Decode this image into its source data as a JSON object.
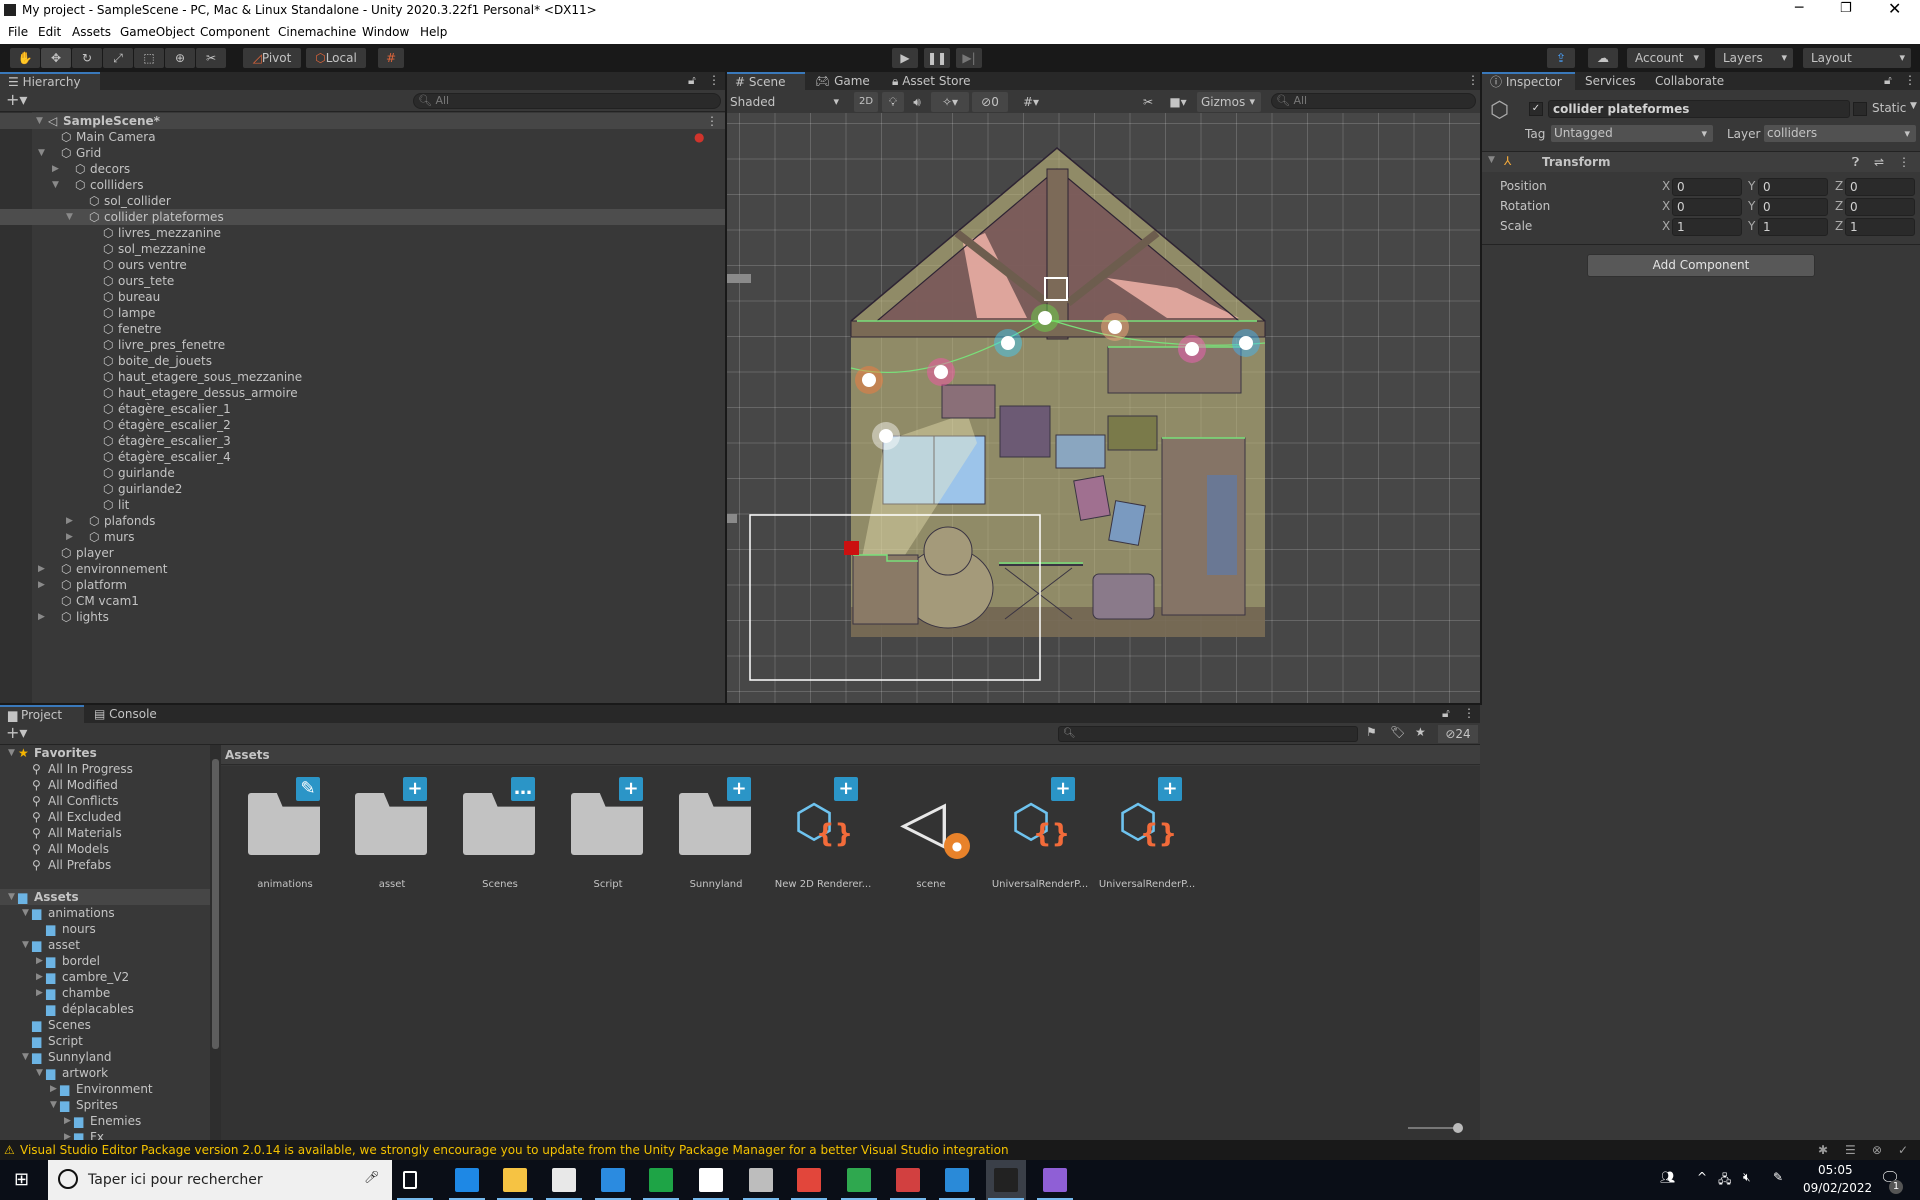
{
  "window": {
    "title": "My project - SampleScene - PC, Mac & Linux Standalone - Unity 2020.3.22f1 Personal* <DX11>"
  },
  "menu": [
    "File",
    "Edit",
    "Assets",
    "GameObject",
    "Component",
    "Cinemachine",
    "Window",
    "Help"
  ],
  "toolbar": {
    "tools": [
      "hand-tool",
      "move-tool",
      "rotate-tool",
      "scale-tool",
      "rect-tool",
      "transform-tool",
      "custom-tool"
    ],
    "active_tool": "move-tool",
    "pivot_label": "Pivot",
    "local_label": "Local",
    "account_label": "Account",
    "layers_label": "Layers",
    "layout_label": "Layout"
  },
  "hierarchy": {
    "tab_label": "Hierarchy",
    "search_placeholder": "All",
    "items": [
      {
        "label": "SampleScene*",
        "depth": 0,
        "arrow": "down",
        "scene": true
      },
      {
        "label": "Main Camera",
        "depth": 1,
        "arrow": null,
        "flag": true
      },
      {
        "label": "Grid",
        "depth": 1,
        "arrow": "down"
      },
      {
        "label": "decors",
        "depth": 2,
        "arrow": "right"
      },
      {
        "label": "collliders",
        "depth": 2,
        "arrow": "down"
      },
      {
        "label": "sol_collider",
        "depth": 3,
        "arrow": null
      },
      {
        "label": "collider plateformes",
        "depth": 3,
        "arrow": "down",
        "selected": true
      },
      {
        "label": "livres_mezzanine",
        "depth": 4,
        "arrow": null
      },
      {
        "label": "sol_mezzanine",
        "depth": 4,
        "arrow": null
      },
      {
        "label": "ours ventre",
        "depth": 4,
        "arrow": null
      },
      {
        "label": "ours_tete",
        "depth": 4,
        "arrow": null
      },
      {
        "label": "bureau",
        "depth": 4,
        "arrow": null
      },
      {
        "label": "lampe",
        "depth": 4,
        "arrow": null
      },
      {
        "label": "fenetre",
        "depth": 4,
        "arrow": null
      },
      {
        "label": "livre_pres_fenetre",
        "depth": 4,
        "arrow": null
      },
      {
        "label": "boite_de_jouets",
        "depth": 4,
        "arrow": null
      },
      {
        "label": "haut_etagere_sous_mezzanine",
        "depth": 4,
        "arrow": null
      },
      {
        "label": "haut_etagere_dessus_armoire",
        "depth": 4,
        "arrow": null
      },
      {
        "label": "étagère_escalier_1",
        "depth": 4,
        "arrow": null
      },
      {
        "label": "étagère_escalier_2",
        "depth": 4,
        "arrow": null
      },
      {
        "label": "étagère_escalier_3",
        "depth": 4,
        "arrow": null
      },
      {
        "label": "étagère_escalier_4",
        "depth": 4,
        "arrow": null
      },
      {
        "label": "guirlande",
        "depth": 4,
        "arrow": null
      },
      {
        "label": "guirlande2",
        "depth": 4,
        "arrow": null
      },
      {
        "label": "lit",
        "depth": 4,
        "arrow": null
      },
      {
        "label": "plafonds",
        "depth": 3,
        "arrow": "right"
      },
      {
        "label": "murs",
        "depth": 3,
        "arrow": "right"
      },
      {
        "label": "player",
        "depth": 1,
        "arrow": null
      },
      {
        "label": "environnement",
        "depth": 1,
        "arrow": "right"
      },
      {
        "label": "platform",
        "depth": 1,
        "arrow": "right"
      },
      {
        "label": "CM vcam1",
        "depth": 1,
        "arrow": null
      },
      {
        "label": "lights",
        "depth": 1,
        "arrow": "right"
      }
    ]
  },
  "scene": {
    "tabs": [
      {
        "label": "Scene",
        "icon": "grid-icon",
        "active": true
      },
      {
        "label": "Game",
        "icon": "gamepad-icon"
      },
      {
        "label": "Asset Store",
        "icon": "bag-icon"
      }
    ],
    "shading_mode": "Shaded",
    "mode_2d": "2D",
    "hidden_count": "0",
    "gizmos_label": "Gizmos",
    "search_placeholder": "All",
    "light_colors": [
      "#ff7a3a",
      "#ff4fb0",
      "#3fd0ff",
      "#6be04a",
      "#ffb080",
      "#ff5fc0",
      "#3fb8ff",
      "#ffffff"
    ]
  },
  "inspector": {
    "tabs": [
      "Inspector",
      "Services",
      "Collaborate"
    ],
    "active": true,
    "object_name": "collider plateformes",
    "static_label": "Static",
    "static": false,
    "tag_label": "Tag",
    "tag_value": "Untagged",
    "layer_label": "Layer",
    "layer_value": "colliders",
    "transform": {
      "title": "Transform",
      "rows": [
        {
          "label": "Position",
          "x": "0",
          "y": "0",
          "z": "0"
        },
        {
          "label": "Rotation",
          "x": "0",
          "y": "0",
          "z": "0"
        },
        {
          "label": "Scale",
          "x": "1",
          "y": "1",
          "z": "1"
        }
      ],
      "axes": [
        "X",
        "Y",
        "Z"
      ]
    },
    "add_component_label": "Add Component"
  },
  "project": {
    "tabs": [
      "Project",
      "Console"
    ],
    "hidden_count": "24",
    "breadcrumb": "Assets",
    "tree": [
      {
        "label": "Favorites",
        "depth": 0,
        "arrow": "down",
        "type": "star",
        "bold": true
      },
      {
        "label": "All In Progress",
        "depth": 1,
        "type": "search"
      },
      {
        "label": "All Modified",
        "depth": 1,
        "type": "search"
      },
      {
        "label": "All Conflicts",
        "depth": 1,
        "type": "search"
      },
      {
        "label": "All Excluded",
        "depth": 1,
        "type": "search"
      },
      {
        "label": "All Materials",
        "depth": 1,
        "type": "search"
      },
      {
        "label": "All Models",
        "depth": 1,
        "type": "search"
      },
      {
        "label": "All Prefabs",
        "depth": 1,
        "type": "search"
      },
      {
        "label": "",
        "depth": 0,
        "type": "blank"
      },
      {
        "label": "Assets",
        "depth": 0,
        "arrow": "down",
        "type": "folder",
        "bold": true,
        "selected": true
      },
      {
        "label": "animations",
        "depth": 1,
        "arrow": "down",
        "type": "folder"
      },
      {
        "label": "nours",
        "depth": 2,
        "type": "folder"
      },
      {
        "label": "asset",
        "depth": 1,
        "arrow": "down",
        "type": "folder"
      },
      {
        "label": "bordel",
        "depth": 2,
        "arrow": "right",
        "type": "folder"
      },
      {
        "label": "cambre_V2",
        "depth": 2,
        "arrow": "right",
        "type": "folder"
      },
      {
        "label": "chambe",
        "depth": 2,
        "arrow": "right",
        "type": "folder"
      },
      {
        "label": "déplacables",
        "depth": 2,
        "type": "folder"
      },
      {
        "label": "Scenes",
        "depth": 1,
        "type": "folder"
      },
      {
        "label": "Script",
        "depth": 1,
        "type": "folder"
      },
      {
        "label": "Sunnyland",
        "depth": 1,
        "arrow": "down",
        "type": "folder"
      },
      {
        "label": "artwork",
        "depth": 2,
        "arrow": "down",
        "type": "folder"
      },
      {
        "label": "Environment",
        "depth": 3,
        "arrow": "right",
        "type": "folder"
      },
      {
        "label": "Sprites",
        "depth": 3,
        "arrow": "down",
        "type": "folder"
      },
      {
        "label": "Enemies",
        "depth": 4,
        "arrow": "right",
        "type": "folder"
      },
      {
        "label": "Fx",
        "depth": 4,
        "arrow": "right",
        "type": "folder"
      }
    ],
    "assets": [
      {
        "label": "animations",
        "type": "folder",
        "badge": "pencil"
      },
      {
        "label": "asset",
        "type": "folder",
        "badge": "plus"
      },
      {
        "label": "Scenes",
        "type": "folder",
        "badge": "dots"
      },
      {
        "label": "Script",
        "type": "folder",
        "badge": "plus"
      },
      {
        "label": "Sunnyland",
        "type": "folder",
        "badge": "plus"
      },
      {
        "label": "New 2D Renderer...",
        "type": "renderer",
        "badge": "plus"
      },
      {
        "label": "scene",
        "type": "unity-scene",
        "badge": "user"
      },
      {
        "label": "UniversalRenderP...",
        "type": "renderer",
        "badge": "plus"
      },
      {
        "label": "UniversalRenderP...",
        "type": "renderer",
        "badge": "plus"
      }
    ]
  },
  "status": {
    "message": "Visual Studio Editor Package version 2.0.14 is available, we strongly encourage you to update from the Unity Package Manager for a better Visual Studio integration"
  },
  "taskbar": {
    "search_placeholder": "Taper ici pour rechercher",
    "apps": [
      {
        "name": "task-view",
        "color": "#ffffff"
      },
      {
        "name": "edge",
        "color": "#1e88e5"
      },
      {
        "name": "file-explorer",
        "color": "#f6c343"
      },
      {
        "name": "store",
        "color": "#e8e8e8"
      },
      {
        "name": "mail",
        "color": "#2b8be0"
      },
      {
        "name": "green-app",
        "color": "#1ea446"
      },
      {
        "name": "settings",
        "color": "#ffffff"
      },
      {
        "name": "unity-hub",
        "color": "#bdbdbd"
      },
      {
        "name": "chrome",
        "color": "#e2463b"
      },
      {
        "name": "grid-app",
        "color": "#2fa84f"
      },
      {
        "name": "paint-app",
        "color": "#d24040"
      },
      {
        "name": "photos",
        "color": "#2a8ad8"
      },
      {
        "name": "unity",
        "color": "#222222",
        "active": true
      },
      {
        "name": "visual-studio",
        "color": "#8f5fd6"
      }
    ],
    "time": "05:05",
    "date": "09/02/2022",
    "notifications": "1"
  }
}
